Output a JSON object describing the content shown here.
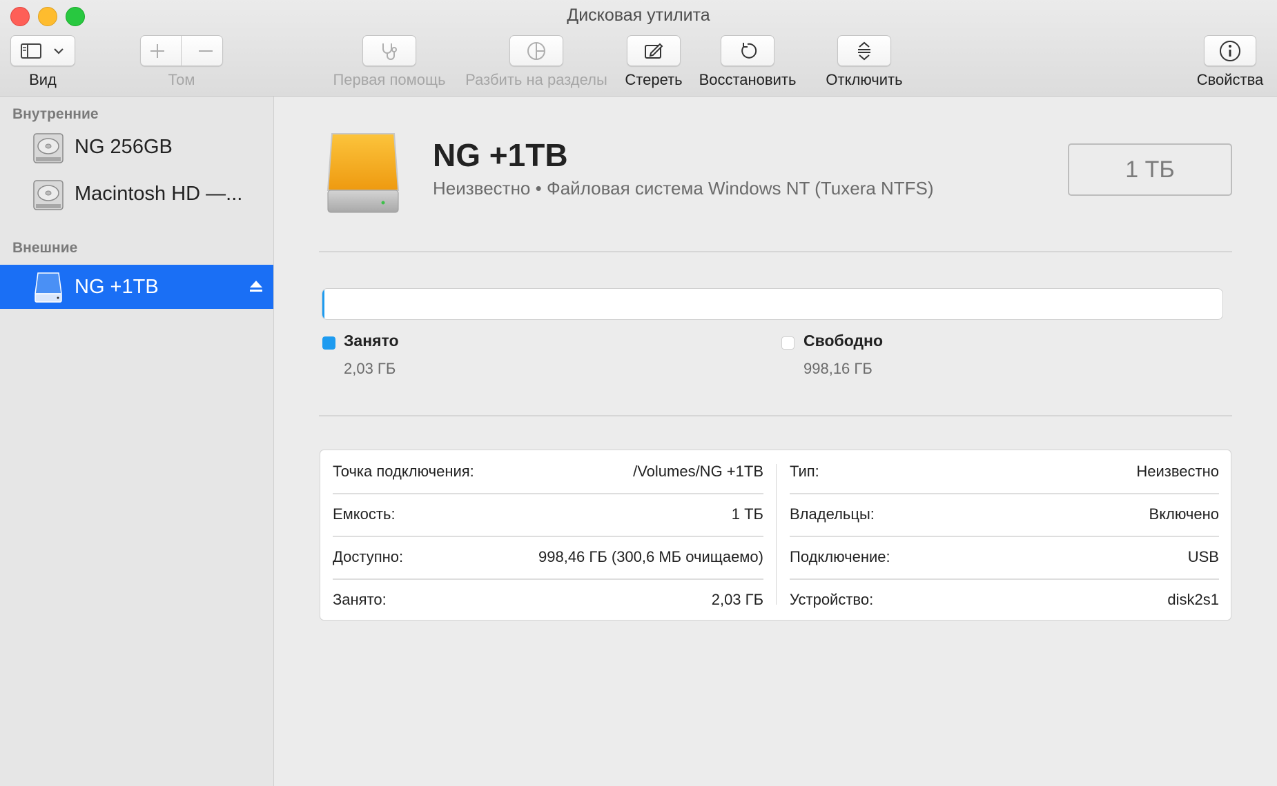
{
  "window": {
    "title": "Дисковая утилита"
  },
  "toolbar": {
    "view_label": "Вид",
    "volume_label": "Том",
    "first_aid_label": "Первая помощь",
    "partition_label": "Разбить на разделы",
    "erase_label": "Стереть",
    "restore_label": "Восстановить",
    "unmount_label": "Отключить",
    "info_label": "Свойства"
  },
  "sidebar": {
    "internal_header": "Внутренние",
    "external_header": "Внешние",
    "internal_items": [
      {
        "label": "NG 256GB",
        "icon": "internal-drive-icon"
      },
      {
        "label": "Macintosh HD —...",
        "icon": "internal-drive-icon"
      }
    ],
    "external_items": [
      {
        "label": "NG +1TB",
        "icon": "external-drive-icon",
        "selected": true
      }
    ]
  },
  "disk": {
    "name": "NG +1TB",
    "subtitle": "Неизвестно • Файловая система Windows NT (Tuxera NTFS)",
    "size": "1 ТБ"
  },
  "usage": {
    "used_label": "Занято",
    "used_value": "2,03 ГБ",
    "free_label": "Свободно",
    "free_value": "998,16 ГБ",
    "used_fraction": 0.002
  },
  "details": {
    "left": [
      {
        "label": "Точка подключения:",
        "value": "/Volumes/NG +1TB"
      },
      {
        "label": "Емкость:",
        "value": "1 ТБ"
      },
      {
        "label": "Доступно:",
        "value": "998,46 ГБ (300,6 МБ очищаемо)"
      },
      {
        "label": "Занято:",
        "value": "2,03 ГБ"
      }
    ],
    "right": [
      {
        "label": "Тип:",
        "value": "Неизвестно"
      },
      {
        "label": "Владельцы:",
        "value": "Включено"
      },
      {
        "label": "Подключение:",
        "value": "USB"
      },
      {
        "label": "Устройство:",
        "value": "disk2s1"
      }
    ]
  },
  "colors": {
    "accent": "#1a6ff5",
    "used": "#1d9bf0",
    "drive_orange": "#f4a81c"
  }
}
